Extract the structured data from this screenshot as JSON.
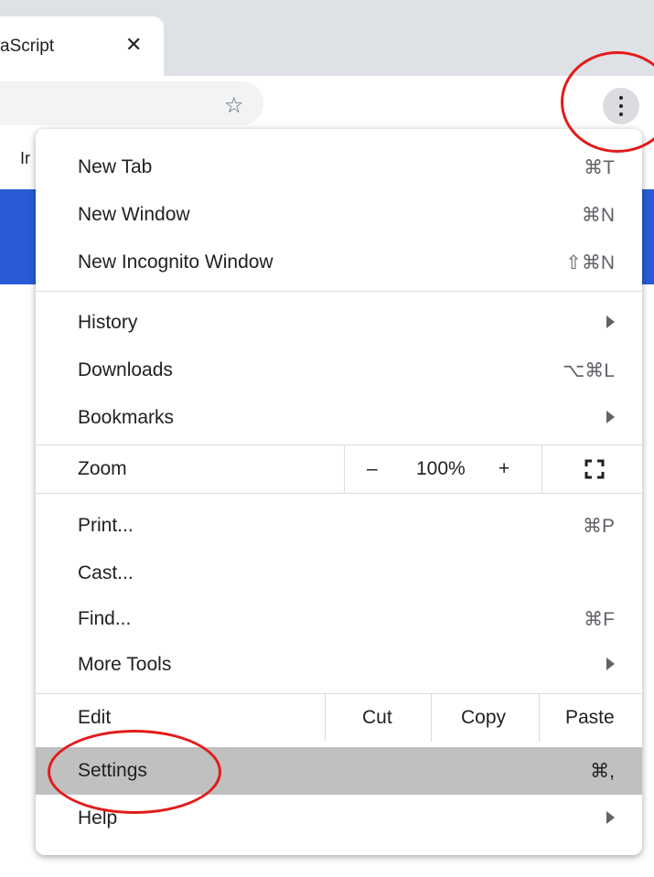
{
  "tab": {
    "title": "aScript",
    "close": "✕"
  },
  "toolbar": {
    "star": "☆"
  },
  "bookmarks": {
    "fragment": "Ir"
  },
  "menu": {
    "new_tab": {
      "label": "New Tab",
      "shortcut": "⌘T"
    },
    "new_window": {
      "label": "New Window",
      "shortcut": "⌘N"
    },
    "new_incognito": {
      "label": "New Incognito Window",
      "shortcut": "⇧⌘N"
    },
    "history": {
      "label": "History"
    },
    "downloads": {
      "label": "Downloads",
      "shortcut": "⌥⌘L"
    },
    "bookmarks": {
      "label": "Bookmarks"
    },
    "zoom": {
      "label": "Zoom",
      "minus": "–",
      "value": "100%",
      "plus": "+",
      "fullscreen": "⛶"
    },
    "print": {
      "label": "Print...",
      "shortcut": "⌘P"
    },
    "cast": {
      "label": "Cast..."
    },
    "find": {
      "label": "Find...",
      "shortcut": "⌘F"
    },
    "more_tools": {
      "label": "More Tools"
    },
    "edit": {
      "label": "Edit",
      "cut": "Cut",
      "copy": "Copy",
      "paste": "Paste"
    },
    "settings": {
      "label": "Settings",
      "shortcut": "⌘,"
    },
    "help": {
      "label": "Help"
    }
  },
  "colors": {
    "highlight": "#c0c0c0",
    "annotation": "#e31b1b",
    "band": "#2a5bd7"
  }
}
